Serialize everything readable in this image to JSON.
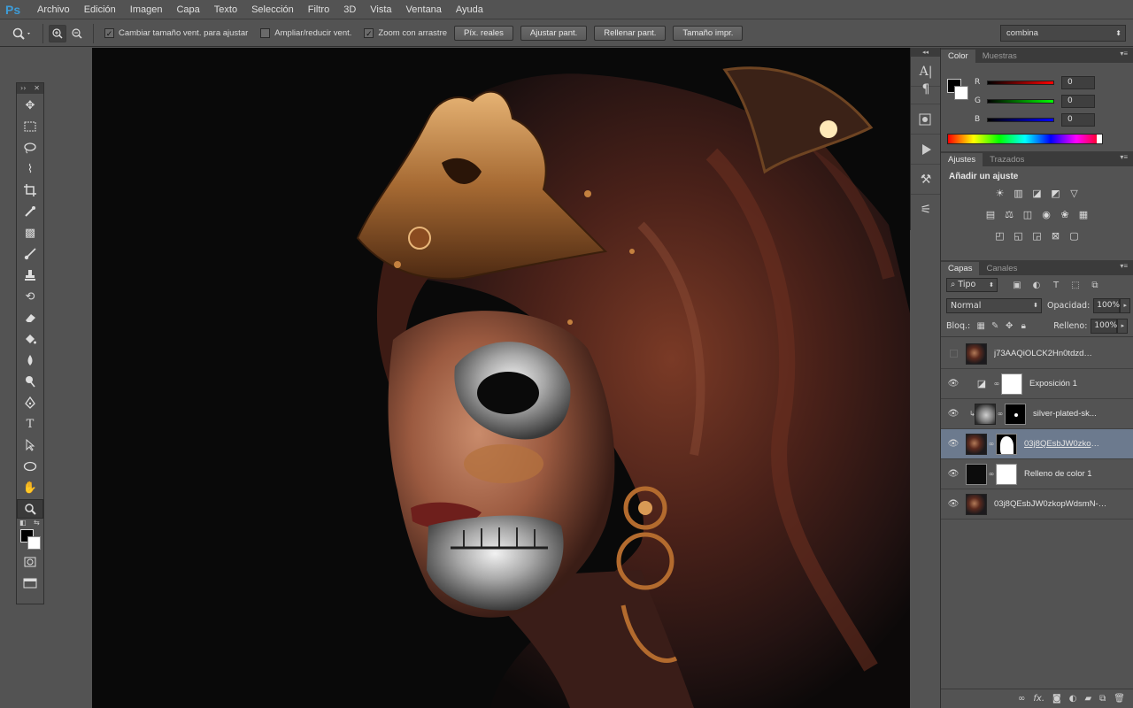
{
  "app": {
    "logo": "Ps"
  },
  "menu": [
    "Archivo",
    "Edición",
    "Imagen",
    "Capa",
    "Texto",
    "Selección",
    "Filtro",
    "3D",
    "Vista",
    "Ventana",
    "Ayuda"
  ],
  "options": {
    "resize_windows": "Cambiar tamaño vent. para ajustar",
    "zoom_all": "Ampliar/reducir vent.",
    "scrubby_zoom": "Zoom con arrastre",
    "actual_pixels": "Píx. reales",
    "fit_screen": "Ajustar pant.",
    "fill_screen": "Rellenar pant.",
    "print_size": "Tamaño impr.",
    "workspace": "combina"
  },
  "color_panel": {
    "tabs": [
      "Color",
      "Muestras"
    ],
    "r_label": "R",
    "g_label": "G",
    "b_label": "B",
    "r": "0",
    "g": "0",
    "b": "0"
  },
  "adjust_panel": {
    "tabs": [
      "Ajustes",
      "Trazados"
    ],
    "title": "Añadir un ajuste"
  },
  "layers_panel": {
    "tabs": [
      "Capas",
      "Canales"
    ],
    "kind": "Tipo",
    "blend_mode": "Normal",
    "opacity_label": "Opacidad:",
    "opacity": "100%",
    "lock_label": "Bloq.:",
    "fill_label": "Relleno:",
    "fill": "100%",
    "layers": [
      {
        "name": "j73AAQiOLCK2Hn0tdzd5--1--...",
        "visible": false
      },
      {
        "name": "Exposición 1",
        "visible": true
      },
      {
        "name": "silver-plated-sk...",
        "visible": true
      },
      {
        "name": "03j8QEsbJW0zkop...",
        "visible": true,
        "selected": true
      },
      {
        "name": "Relleno de color 1",
        "visible": true
      },
      {
        "name": "03j8QEsbJW0zkopWdsmN--1...",
        "visible": true
      }
    ]
  },
  "colors": {
    "accent": "#3e9bd6",
    "selected_layer": "#6c7a8e",
    "canvas_bg": "#090909"
  }
}
